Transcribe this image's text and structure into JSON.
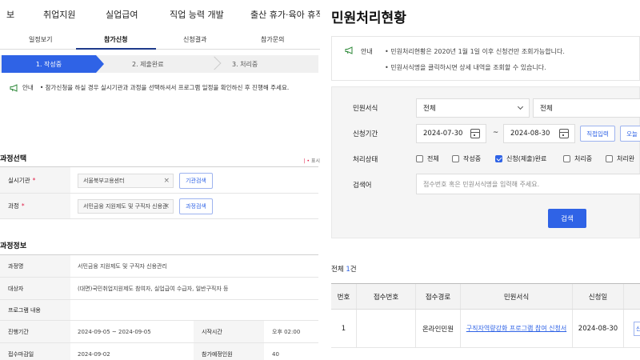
{
  "left": {
    "topnav": [
      "보",
      "취업지원",
      "실업급여",
      "직업 능력 개발",
      "출산 휴가·육아 휴직"
    ],
    "subtabs": [
      "일정보기",
      "참가신청",
      "신청결과",
      "참가문의"
    ],
    "steps": [
      "1. 작성중",
      "2. 제출완료",
      "3. 처리중"
    ],
    "notice_label": "안내",
    "notice_text": "• 참가신청을 하실 경우 실시기관과 과정을 선택하셔서 프로그램 일정을 확인하신 후 진행해 주세요.",
    "section_course_select": "과정선택",
    "required_note": "표시",
    "agency_label": "실시기관",
    "agency_value": "서울북부고용센터",
    "agency_button": "기관검색",
    "course_label": "과정",
    "course_value": "서민금융 지원제도 및 구직자 신용관",
    "course_button": "과정검색",
    "section_course_info": "과정정보",
    "info_rows": [
      {
        "label": "과정명",
        "value": "서민금융 지원제도 및 구직자 신용관리"
      },
      {
        "label": "대상자",
        "value": "(대면)국민취업지원제도 참여자, 실업급여 수급자, 일반구직자 등"
      },
      {
        "label": "프로그램 내용",
        "value": ""
      },
      {
        "label": "진행기간",
        "value": "2024-09-05 ~ 2024-09-05",
        "label2": "시작시간",
        "value2": "오후 02:00"
      },
      {
        "label": "접수마감일",
        "value": "2024-09-02",
        "label2": "참가예정인원",
        "value2": "40"
      }
    ]
  },
  "right": {
    "title": "민원처리현황",
    "notice_label": "안내",
    "notice_lines": [
      "• 민원처리현황은 2020년 1월 1일 이후 신청건만 조회가능합니다.",
      "• 민원서식명을 클릭하시면 상세 내역을 조회할 수 있습니다."
    ],
    "form_label": "민원서식",
    "form_select1": "전체",
    "form_select2": "전체",
    "period_label": "신청기간",
    "date_from": "2024-07-30",
    "date_sep": "~",
    "date_to": "2024-08-30",
    "direct_input": "직접입력",
    "today": "오늘",
    "status_label": "처리상태",
    "status_options": [
      "전체",
      "작성중",
      "신청(제출)완료",
      "처리중",
      "처리완"
    ],
    "status_checked": [
      false,
      false,
      true,
      false,
      false
    ],
    "keyword_label": "검색어",
    "keyword_placeholder": "접수번호 혹은 민원서식명을 입력해 주세요.",
    "search_button": "검색",
    "total_prefix": "전체 ",
    "total_count": "1",
    "total_suffix": "건",
    "table_headers": [
      "번호",
      "접수번호",
      "접수경로",
      "민원서식",
      "신청일"
    ],
    "table_rows": [
      {
        "no": "1",
        "receipt": "",
        "route": "온라인민원",
        "form": "구직자역량강화 프로그램 참여 신청서",
        "date": "2024-08-30",
        "action": "신"
      }
    ]
  },
  "colors": {
    "accent": "#2f63e6",
    "danger": "#e11d48",
    "navy": "#1e3a8a"
  }
}
